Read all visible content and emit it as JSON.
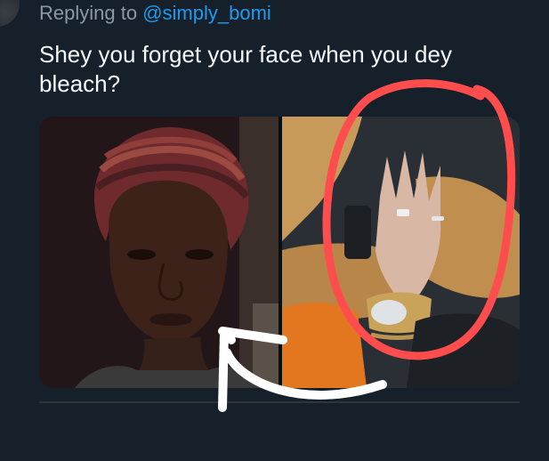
{
  "reply": {
    "prefix": "Replying to ",
    "handle": "@simply_bomi"
  },
  "tweet": {
    "text": "Shey you forget your face when you dey bleach?"
  },
  "media": {
    "count": 2,
    "left_photo": "selfie-photo",
    "right_photo": "hand-with-rings-photo"
  },
  "annotations": {
    "circle_color": "#ff4d4d",
    "arrow_color": "#ffffff"
  },
  "colors": {
    "background": "#15202b",
    "text_primary": "#f7f9f9",
    "text_secondary": "#8b98a5",
    "link": "#1d9bf0"
  }
}
